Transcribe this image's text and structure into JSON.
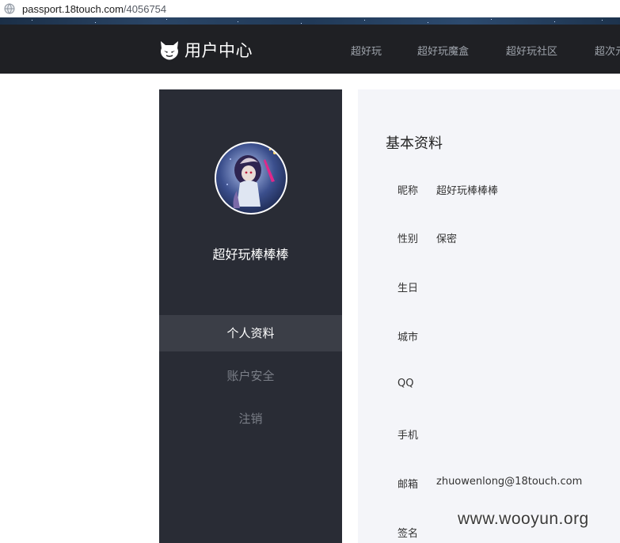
{
  "browser": {
    "url_host": "passport.18touch.com",
    "url_path": "/4056754"
  },
  "header": {
    "title": "用户中心",
    "logo_icon": "devil-cat-logo-icon",
    "nav": [
      "超好玩",
      "超好玩魔盒",
      "超好玩社区",
      "超次元"
    ]
  },
  "sidebar": {
    "username": "超好玩棒棒棒",
    "items": [
      {
        "label": "个人资料",
        "active": true
      },
      {
        "label": "账户安全",
        "active": false
      },
      {
        "label": "注销",
        "active": false
      }
    ]
  },
  "profile": {
    "title": "基本资料",
    "fields": [
      {
        "label": "昵称",
        "value": "超好玩棒棒棒"
      },
      {
        "label": "性别",
        "value": "保密"
      },
      {
        "label": "生日",
        "value": ""
      },
      {
        "label": "城市",
        "value": ""
      },
      {
        "label": "QQ",
        "value": ""
      },
      {
        "label": "手机",
        "value": ""
      },
      {
        "label": "邮箱",
        "value": "zhuowenlong@18touch.com"
      },
      {
        "label": "签名",
        "value": ""
      }
    ]
  },
  "watermark": "www.wooyun.org",
  "colors": {
    "nav_bg": "#1f2024",
    "sidebar_bg": "#292c35",
    "sidebar_active_bg": "#3b3e47",
    "panel_bg": "#f4f5f9"
  }
}
